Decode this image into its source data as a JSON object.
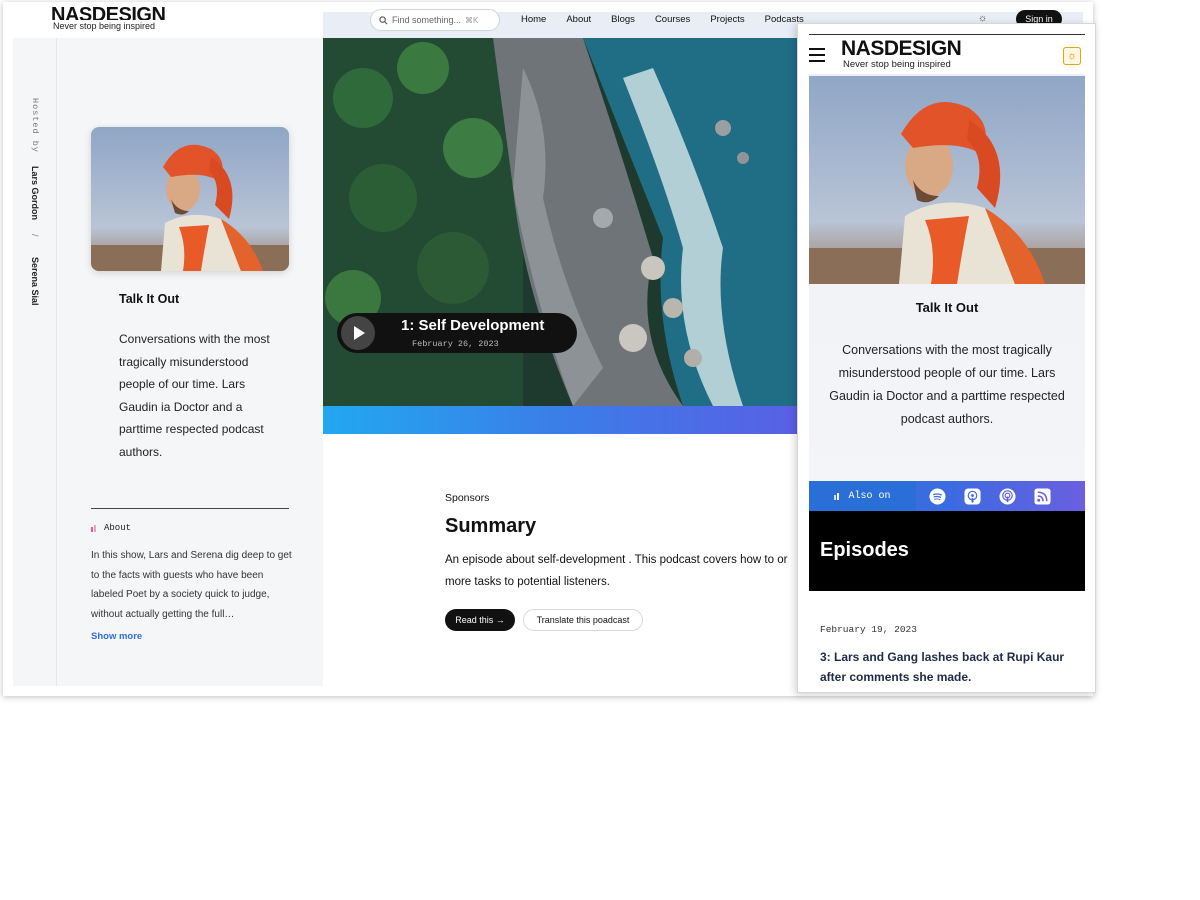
{
  "desktop": {
    "brand": {
      "name": "NASDESIGN",
      "tagline": "Never stop being inspired"
    },
    "search": {
      "placeholder": "Find something...",
      "shortcut": "⌘K"
    },
    "nav": [
      "Home",
      "About",
      "Blogs",
      "Courses",
      "Projects",
      "Podcasts"
    ],
    "signin_label": "Sign in",
    "sidebar": {
      "hosted_by": "Hosted by",
      "hosts": [
        "Lars Gordon",
        "Serena Sial"
      ],
      "separator": "/"
    },
    "show": {
      "title": "Talk It Out",
      "description": "Conversations with the most tragically misunderstood people of our time. Lars Gaudin ia Doctor and a parttime respected podcast authors."
    },
    "about": {
      "heading": "About",
      "text": "In this show, Lars and Serena dig deep to get to the facts with guests who have been labeled Poet by a society quick to judge, without actually getting the full…",
      "show_more": "Show more"
    },
    "player": {
      "title": "1: Self Development",
      "date": "February 26, 2023"
    },
    "summary": {
      "sponsors": "Sponsors",
      "heading": "Summary",
      "text": "An episode about self-development . This podcast covers how to or more tasks to potential listeners.",
      "read_label": "Read this →",
      "translate_label": "Translate this poadcast"
    }
  },
  "mobile": {
    "brand": {
      "name": "NASDESIGN",
      "tagline": "Never stop being inspired"
    },
    "show_title": "Talk It Out",
    "show_description": "Conversations with the most tragically misunderstood people of our time. Lars Gaudin ia Doctor and a parttime respected podcast authors.",
    "also_on": "Also on",
    "platforms": [
      "spotify-icon",
      "apple-podcasts-icon",
      "podcast-icon",
      "rss-icon"
    ],
    "episodes_heading": "Episodes",
    "episode": {
      "date": "February 19, 2023",
      "title": "3: Lars and Gang lashes back at Rupi Kaur after comments she made."
    }
  },
  "colors": {
    "accent_blue": "#2f6fdf",
    "dark": "#111111",
    "gradient_start": "#22a8f0",
    "gradient_end": "#5a5fe4"
  }
}
